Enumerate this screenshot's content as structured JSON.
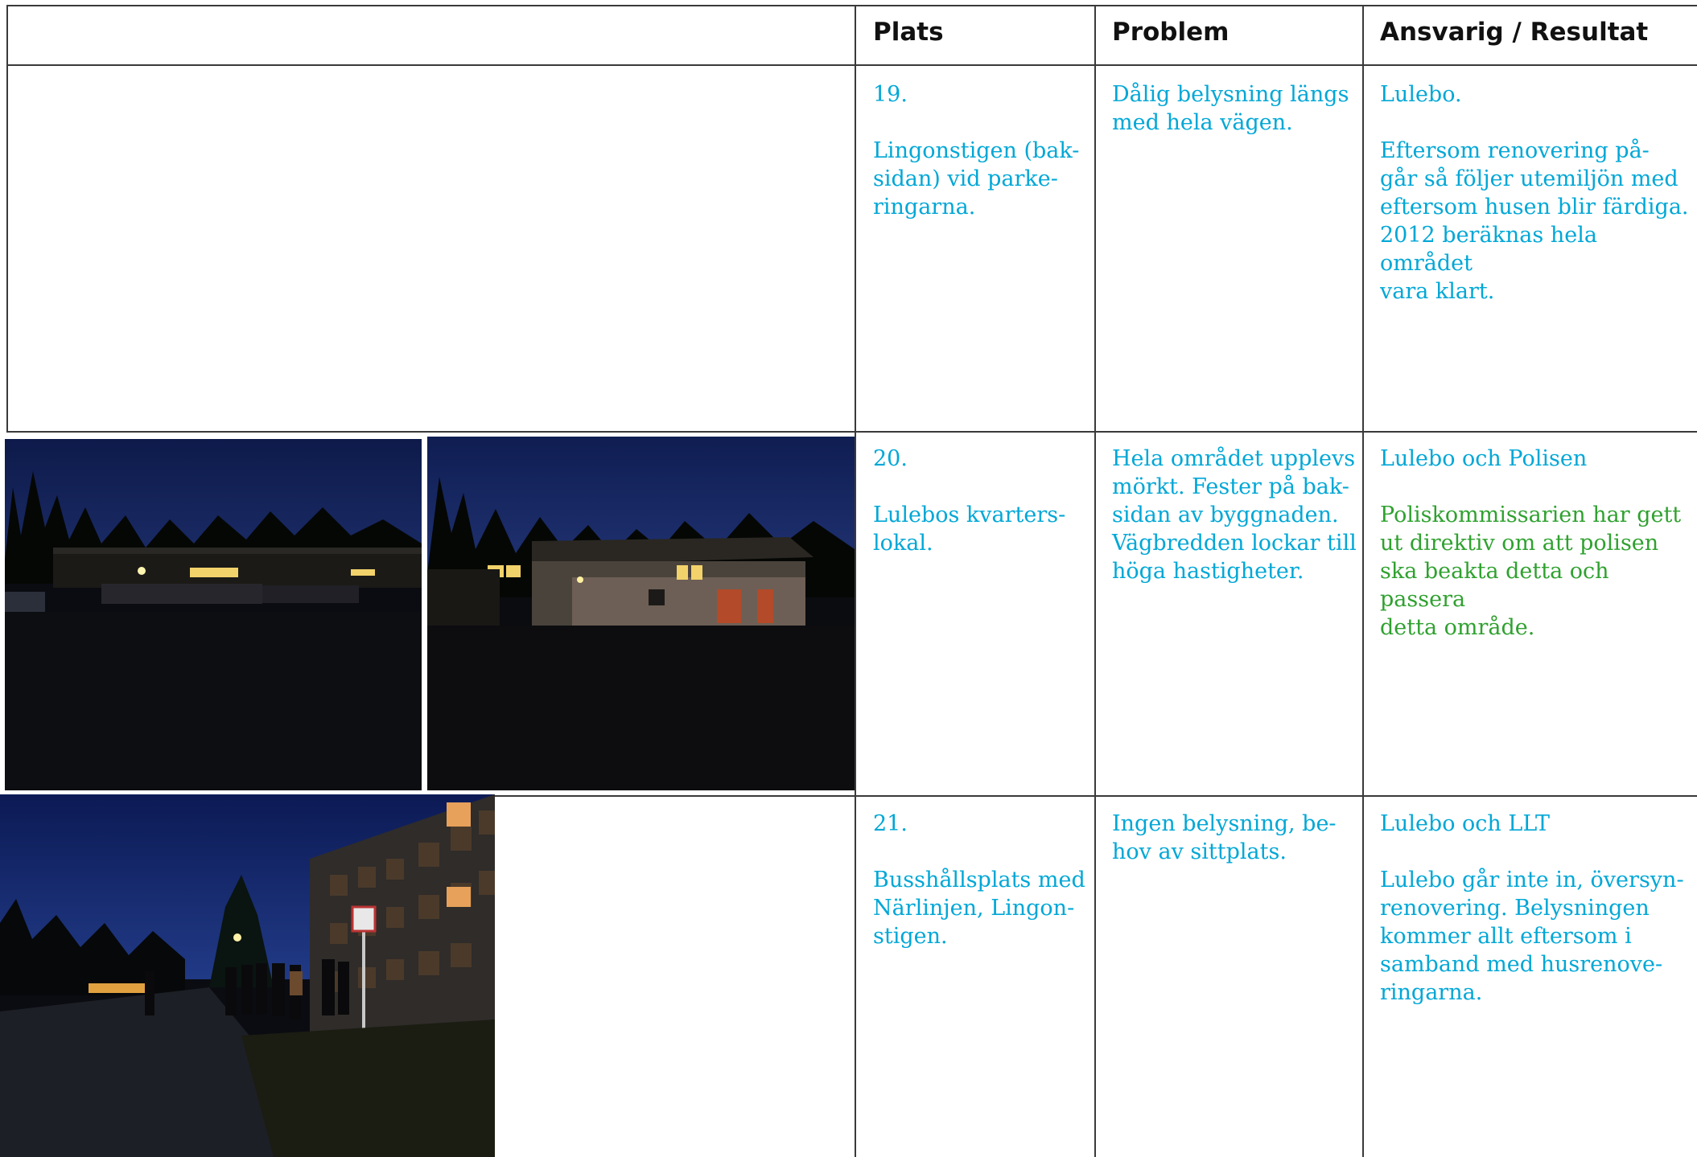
{
  "headers": {
    "plats": "Plats",
    "problem": "Problem",
    "ansvarig": "Ansvarig / Resultat"
  },
  "rows": [
    {
      "number": "19.",
      "plats": [
        "Lingonstigen (bak-",
        "sidan) vid parke-",
        "ringarna."
      ],
      "problem": [
        "Dålig belysning längs",
        "med hela vägen."
      ],
      "ansvarig": "Lulebo.",
      "resultat": [
        "Eftersom renovering på-",
        "går så följer utemiljön med",
        "eftersom husen blir färdiga.",
        "2012 beräknas hela området",
        "vara klart."
      ]
    },
    {
      "number": "20.",
      "plats": [
        "Lulebos kvarters-",
        "lokal."
      ],
      "problem": [
        "Hela området upplevs",
        "mörkt. Fester på bak-",
        "sidan av byggnaden.",
        "Vägbredden lockar till",
        "höga hastigheter."
      ],
      "ansvarig": "Lulebo och Polisen",
      "resultat": [
        "Poliskommissarien har gett",
        "ut direktiv om att polisen",
        "ska beakta detta och passera",
        "detta område."
      ]
    },
    {
      "number": "21.",
      "plats": [
        "Busshållsplats med",
        "Närlinjen, Lingon-",
        "stigen."
      ],
      "problem": [
        "Ingen belysning, be-",
        "hov av sittplats."
      ],
      "ansvarig": "Lulebo och LLT",
      "resultat": [
        "Lulebo går inte in, översyn-",
        "renovering. Belysningen",
        "kommer allt eftersom i",
        "samband med husrenove-",
        "ringarna."
      ]
    }
  ],
  "colors": {
    "text_blue": "#00a7d6",
    "text_green": "#2fa12f",
    "grid": "#3a3a3a"
  }
}
